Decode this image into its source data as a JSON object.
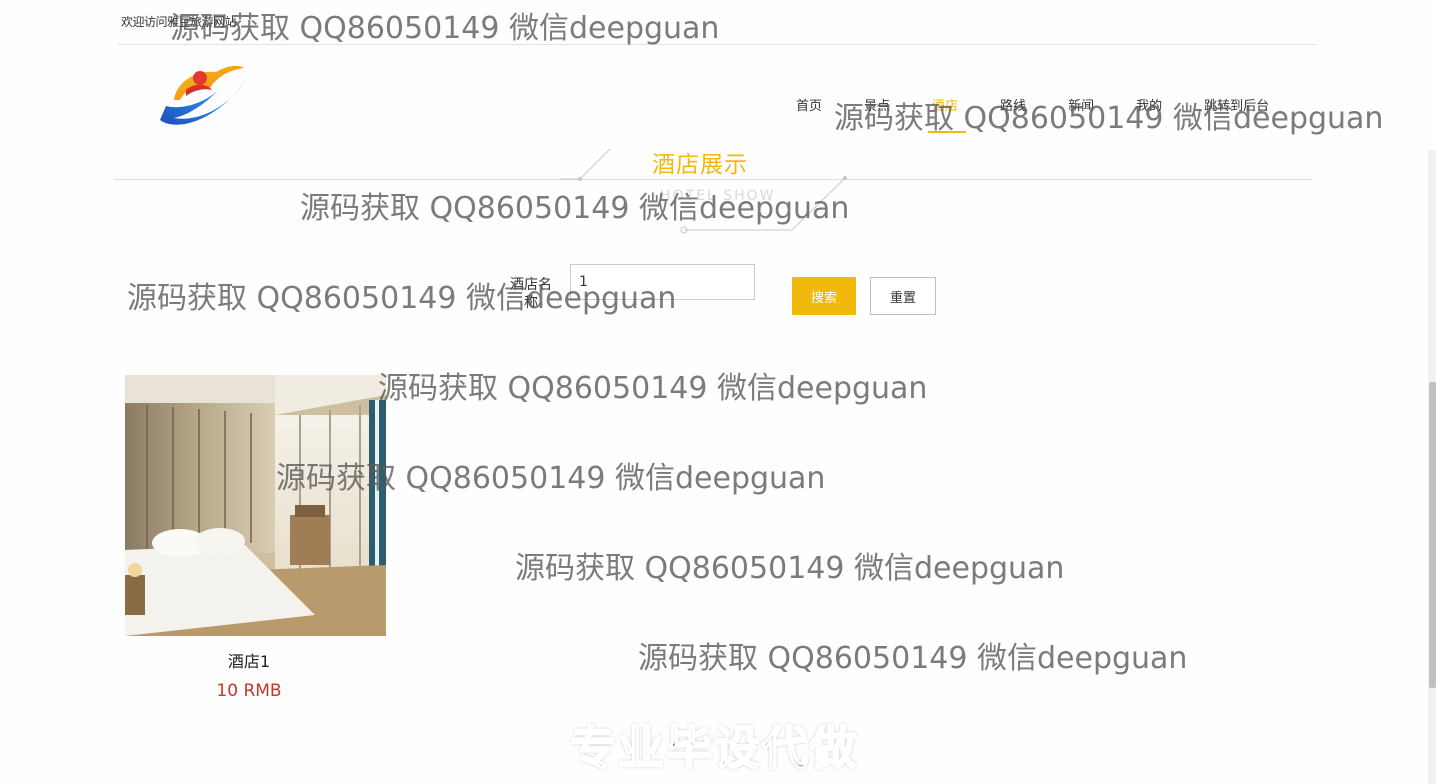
{
  "header": {
    "welcome_text": "欢迎访问雅豆旅游网站",
    "logo_icon": "colorful-swoosh-logo"
  },
  "nav": {
    "items": [
      {
        "label": "首页",
        "active": false
      },
      {
        "label": "景点",
        "active": false
      },
      {
        "label": "酒店",
        "active": true
      },
      {
        "label": "路线",
        "active": false
      },
      {
        "label": "新闻",
        "active": false
      },
      {
        "label": "我的",
        "active": false
      },
      {
        "label": "跳转到后台",
        "active": false
      }
    ]
  },
  "section": {
    "title": "酒店展示",
    "subtitle": "HOTEL SHOW"
  },
  "search": {
    "label": "酒店名称",
    "value": "1",
    "search_button": "搜索",
    "reset_button": "重置"
  },
  "hotels": [
    {
      "name": "酒店1",
      "price": "10 RMB"
    }
  ],
  "watermarks": [
    "源码获取 QQ86050149 微信deepguan",
    "源码获取 QQ86050149 微信deepguan",
    "源码获取 QQ86050149 微信deepguan",
    "源码获取 QQ86050149 微信deepguan",
    "源码获取 QQ86050149 微信deepguan",
    "源码获取 QQ86050149 微信deepguan",
    "源码获取 QQ86050149 微信deepguan",
    "源码获取 QQ86050149 微信deepguan"
  ],
  "banner_watermark": "专业毕设代做",
  "colors": {
    "accent": "#f1b90c",
    "price": "#c0392b"
  }
}
